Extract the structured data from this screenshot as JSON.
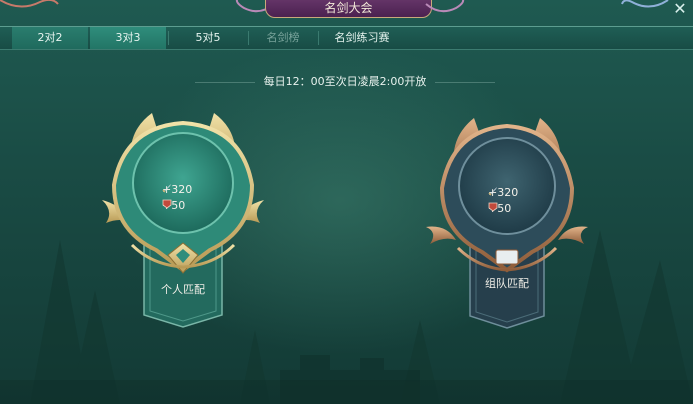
{
  "window": {
    "title": "名剑大会",
    "close_symbol": "✕"
  },
  "tabs": [
    {
      "label": "2对2",
      "state": "selected"
    },
    {
      "label": "3对3",
      "state": "highlighted"
    },
    {
      "label": "5对5",
      "state": "normal"
    },
    {
      "label": "名剑榜",
      "state": "dim"
    },
    {
      "label": "名剑练习赛",
      "state": "normal"
    }
  ],
  "schedule_text": "每日12：00至次日凌晨2:00开放",
  "modes": [
    {
      "label": "个人匹配",
      "theme": "jade-gold",
      "rewards": [
        {
          "icon": "sword-icon",
          "value": "+320"
        },
        {
          "icon": "badge-icon",
          "value": "+50"
        }
      ]
    },
    {
      "label": "组队匹配",
      "theme": "slate-bronze",
      "rewards": [
        {
          "icon": "sword-icon",
          "value": "+320"
        },
        {
          "icon": "badge-icon",
          "value": "+50"
        }
      ]
    }
  ],
  "colors": {
    "background": "#1a4c45",
    "active_tab": "#2f8d7c",
    "gold": "#d8c07a",
    "jade": "#3a9b86",
    "slate": "#2c4d5c",
    "bronze": "#b9875a",
    "badge_red": "#c24a3c"
  }
}
